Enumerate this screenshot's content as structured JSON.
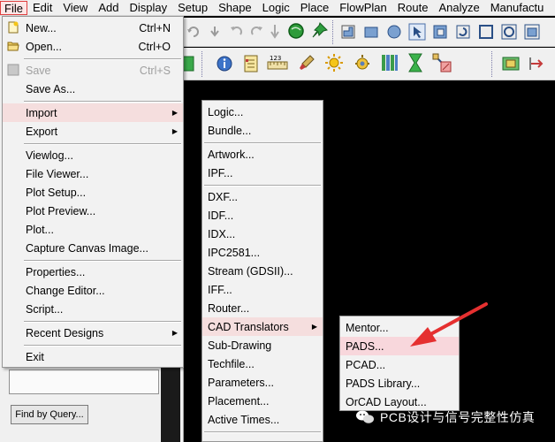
{
  "menubar": {
    "items": [
      "File",
      "Edit",
      "View",
      "Add",
      "Display",
      "Setup",
      "Shape",
      "Logic",
      "Place",
      "FlowPlan",
      "Route",
      "Analyze",
      "Manufactu"
    ]
  },
  "file_menu": {
    "items": [
      {
        "label": "New...",
        "shortcut": "Ctrl+N",
        "icon": "new-file-icon"
      },
      {
        "label": "Open...",
        "shortcut": "Ctrl+O",
        "icon": "open-folder-icon"
      },
      {
        "label": "Save",
        "shortcut": "Ctrl+S",
        "disabled": true,
        "icon": "save-icon"
      },
      {
        "label": "Save As..."
      },
      {
        "label": "Import",
        "submenu": true,
        "highlighted": true
      },
      {
        "label": "Export",
        "submenu": true
      },
      {
        "label": "Viewlog..."
      },
      {
        "label": "File Viewer..."
      },
      {
        "label": "Plot Setup..."
      },
      {
        "label": "Plot Preview..."
      },
      {
        "label": "Plot..."
      },
      {
        "label": "Capture Canvas Image..."
      },
      {
        "label": "Properties..."
      },
      {
        "label": "Change Editor..."
      },
      {
        "label": "Script..."
      },
      {
        "label": "Recent Designs",
        "submenu": true
      },
      {
        "label": "Exit"
      }
    ]
  },
  "import_menu": {
    "items": [
      {
        "label": "Logic..."
      },
      {
        "label": "Bundle..."
      },
      {
        "label": "Artwork..."
      },
      {
        "label": "IPF..."
      },
      {
        "label": "DXF..."
      },
      {
        "label": "IDF..."
      },
      {
        "label": "IDX..."
      },
      {
        "label": "IPC2581..."
      },
      {
        "label": "Stream (GDSII)..."
      },
      {
        "label": "IFF..."
      },
      {
        "label": "Router..."
      },
      {
        "label": "CAD Translators",
        "submenu": true,
        "highlighted": true
      },
      {
        "label": "Sub-Drawing"
      },
      {
        "label": "Techfile..."
      },
      {
        "label": "Parameters..."
      },
      {
        "label": "Placement..."
      },
      {
        "label": "Active Times..."
      }
    ]
  },
  "translators_menu": {
    "items": [
      {
        "label": "Mentor..."
      },
      {
        "label": "PADS...",
        "highlighted": true
      },
      {
        "label": "PCAD..."
      },
      {
        "label": "PADS Library..."
      },
      {
        "label": "OrCAD Layout..."
      }
    ]
  },
  "left_panel": {
    "find_button": "Find by Query..."
  },
  "toolbar": {
    "label_123": "123"
  },
  "watermark": {
    "text": "PCB设计与信号完整性仿真"
  },
  "colors": {
    "menu_bg": "#f2f2f2",
    "highlight": "#f5dede",
    "arrow": "#e53030",
    "canvas": "#000000"
  }
}
